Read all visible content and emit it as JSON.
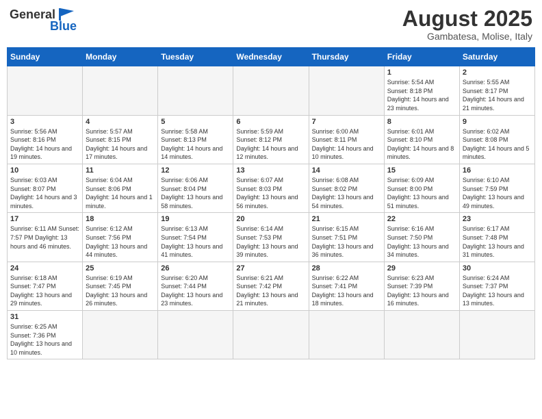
{
  "logo": {
    "text_general": "General",
    "text_blue": "Blue"
  },
  "title": {
    "month_year": "August 2025",
    "location": "Gambatesa, Molise, Italy"
  },
  "weekdays": [
    "Sunday",
    "Monday",
    "Tuesday",
    "Wednesday",
    "Thursday",
    "Friday",
    "Saturday"
  ],
  "weeks": [
    [
      {
        "day": "",
        "info": ""
      },
      {
        "day": "",
        "info": ""
      },
      {
        "day": "",
        "info": ""
      },
      {
        "day": "",
        "info": ""
      },
      {
        "day": "",
        "info": ""
      },
      {
        "day": "1",
        "info": "Sunrise: 5:54 AM\nSunset: 8:18 PM\nDaylight: 14 hours and 23 minutes."
      },
      {
        "day": "2",
        "info": "Sunrise: 5:55 AM\nSunset: 8:17 PM\nDaylight: 14 hours and 21 minutes."
      }
    ],
    [
      {
        "day": "3",
        "info": "Sunrise: 5:56 AM\nSunset: 8:16 PM\nDaylight: 14 hours and 19 minutes."
      },
      {
        "day": "4",
        "info": "Sunrise: 5:57 AM\nSunset: 8:15 PM\nDaylight: 14 hours and 17 minutes."
      },
      {
        "day": "5",
        "info": "Sunrise: 5:58 AM\nSunset: 8:13 PM\nDaylight: 14 hours and 14 minutes."
      },
      {
        "day": "6",
        "info": "Sunrise: 5:59 AM\nSunset: 8:12 PM\nDaylight: 14 hours and 12 minutes."
      },
      {
        "day": "7",
        "info": "Sunrise: 6:00 AM\nSunset: 8:11 PM\nDaylight: 14 hours and 10 minutes."
      },
      {
        "day": "8",
        "info": "Sunrise: 6:01 AM\nSunset: 8:10 PM\nDaylight: 14 hours and 8 minutes."
      },
      {
        "day": "9",
        "info": "Sunrise: 6:02 AM\nSunset: 8:08 PM\nDaylight: 14 hours and 5 minutes."
      }
    ],
    [
      {
        "day": "10",
        "info": "Sunrise: 6:03 AM\nSunset: 8:07 PM\nDaylight: 14 hours and 3 minutes."
      },
      {
        "day": "11",
        "info": "Sunrise: 6:04 AM\nSunset: 8:06 PM\nDaylight: 14 hours and 1 minute."
      },
      {
        "day": "12",
        "info": "Sunrise: 6:06 AM\nSunset: 8:04 PM\nDaylight: 13 hours and 58 minutes."
      },
      {
        "day": "13",
        "info": "Sunrise: 6:07 AM\nSunset: 8:03 PM\nDaylight: 13 hours and 56 minutes."
      },
      {
        "day": "14",
        "info": "Sunrise: 6:08 AM\nSunset: 8:02 PM\nDaylight: 13 hours and 54 minutes."
      },
      {
        "day": "15",
        "info": "Sunrise: 6:09 AM\nSunset: 8:00 PM\nDaylight: 13 hours and 51 minutes."
      },
      {
        "day": "16",
        "info": "Sunrise: 6:10 AM\nSunset: 7:59 PM\nDaylight: 13 hours and 49 minutes."
      }
    ],
    [
      {
        "day": "17",
        "info": "Sunrise: 6:11 AM\nSunset: 7:57 PM\nDaylight: 13 hours and 46 minutes."
      },
      {
        "day": "18",
        "info": "Sunrise: 6:12 AM\nSunset: 7:56 PM\nDaylight: 13 hours and 44 minutes."
      },
      {
        "day": "19",
        "info": "Sunrise: 6:13 AM\nSunset: 7:54 PM\nDaylight: 13 hours and 41 minutes."
      },
      {
        "day": "20",
        "info": "Sunrise: 6:14 AM\nSunset: 7:53 PM\nDaylight: 13 hours and 39 minutes."
      },
      {
        "day": "21",
        "info": "Sunrise: 6:15 AM\nSunset: 7:51 PM\nDaylight: 13 hours and 36 minutes."
      },
      {
        "day": "22",
        "info": "Sunrise: 6:16 AM\nSunset: 7:50 PM\nDaylight: 13 hours and 34 minutes."
      },
      {
        "day": "23",
        "info": "Sunrise: 6:17 AM\nSunset: 7:48 PM\nDaylight: 13 hours and 31 minutes."
      }
    ],
    [
      {
        "day": "24",
        "info": "Sunrise: 6:18 AM\nSunset: 7:47 PM\nDaylight: 13 hours and 29 minutes."
      },
      {
        "day": "25",
        "info": "Sunrise: 6:19 AM\nSunset: 7:45 PM\nDaylight: 13 hours and 26 minutes."
      },
      {
        "day": "26",
        "info": "Sunrise: 6:20 AM\nSunset: 7:44 PM\nDaylight: 13 hours and 23 minutes."
      },
      {
        "day": "27",
        "info": "Sunrise: 6:21 AM\nSunset: 7:42 PM\nDaylight: 13 hours and 21 minutes."
      },
      {
        "day": "28",
        "info": "Sunrise: 6:22 AM\nSunset: 7:41 PM\nDaylight: 13 hours and 18 minutes."
      },
      {
        "day": "29",
        "info": "Sunrise: 6:23 AM\nSunset: 7:39 PM\nDaylight: 13 hours and 16 minutes."
      },
      {
        "day": "30",
        "info": "Sunrise: 6:24 AM\nSunset: 7:37 PM\nDaylight: 13 hours and 13 minutes."
      }
    ],
    [
      {
        "day": "31",
        "info": "Sunrise: 6:25 AM\nSunset: 7:36 PM\nDaylight: 13 hours and 10 minutes."
      },
      {
        "day": "",
        "info": ""
      },
      {
        "day": "",
        "info": ""
      },
      {
        "day": "",
        "info": ""
      },
      {
        "day": "",
        "info": ""
      },
      {
        "day": "",
        "info": ""
      },
      {
        "day": "",
        "info": ""
      }
    ]
  ]
}
